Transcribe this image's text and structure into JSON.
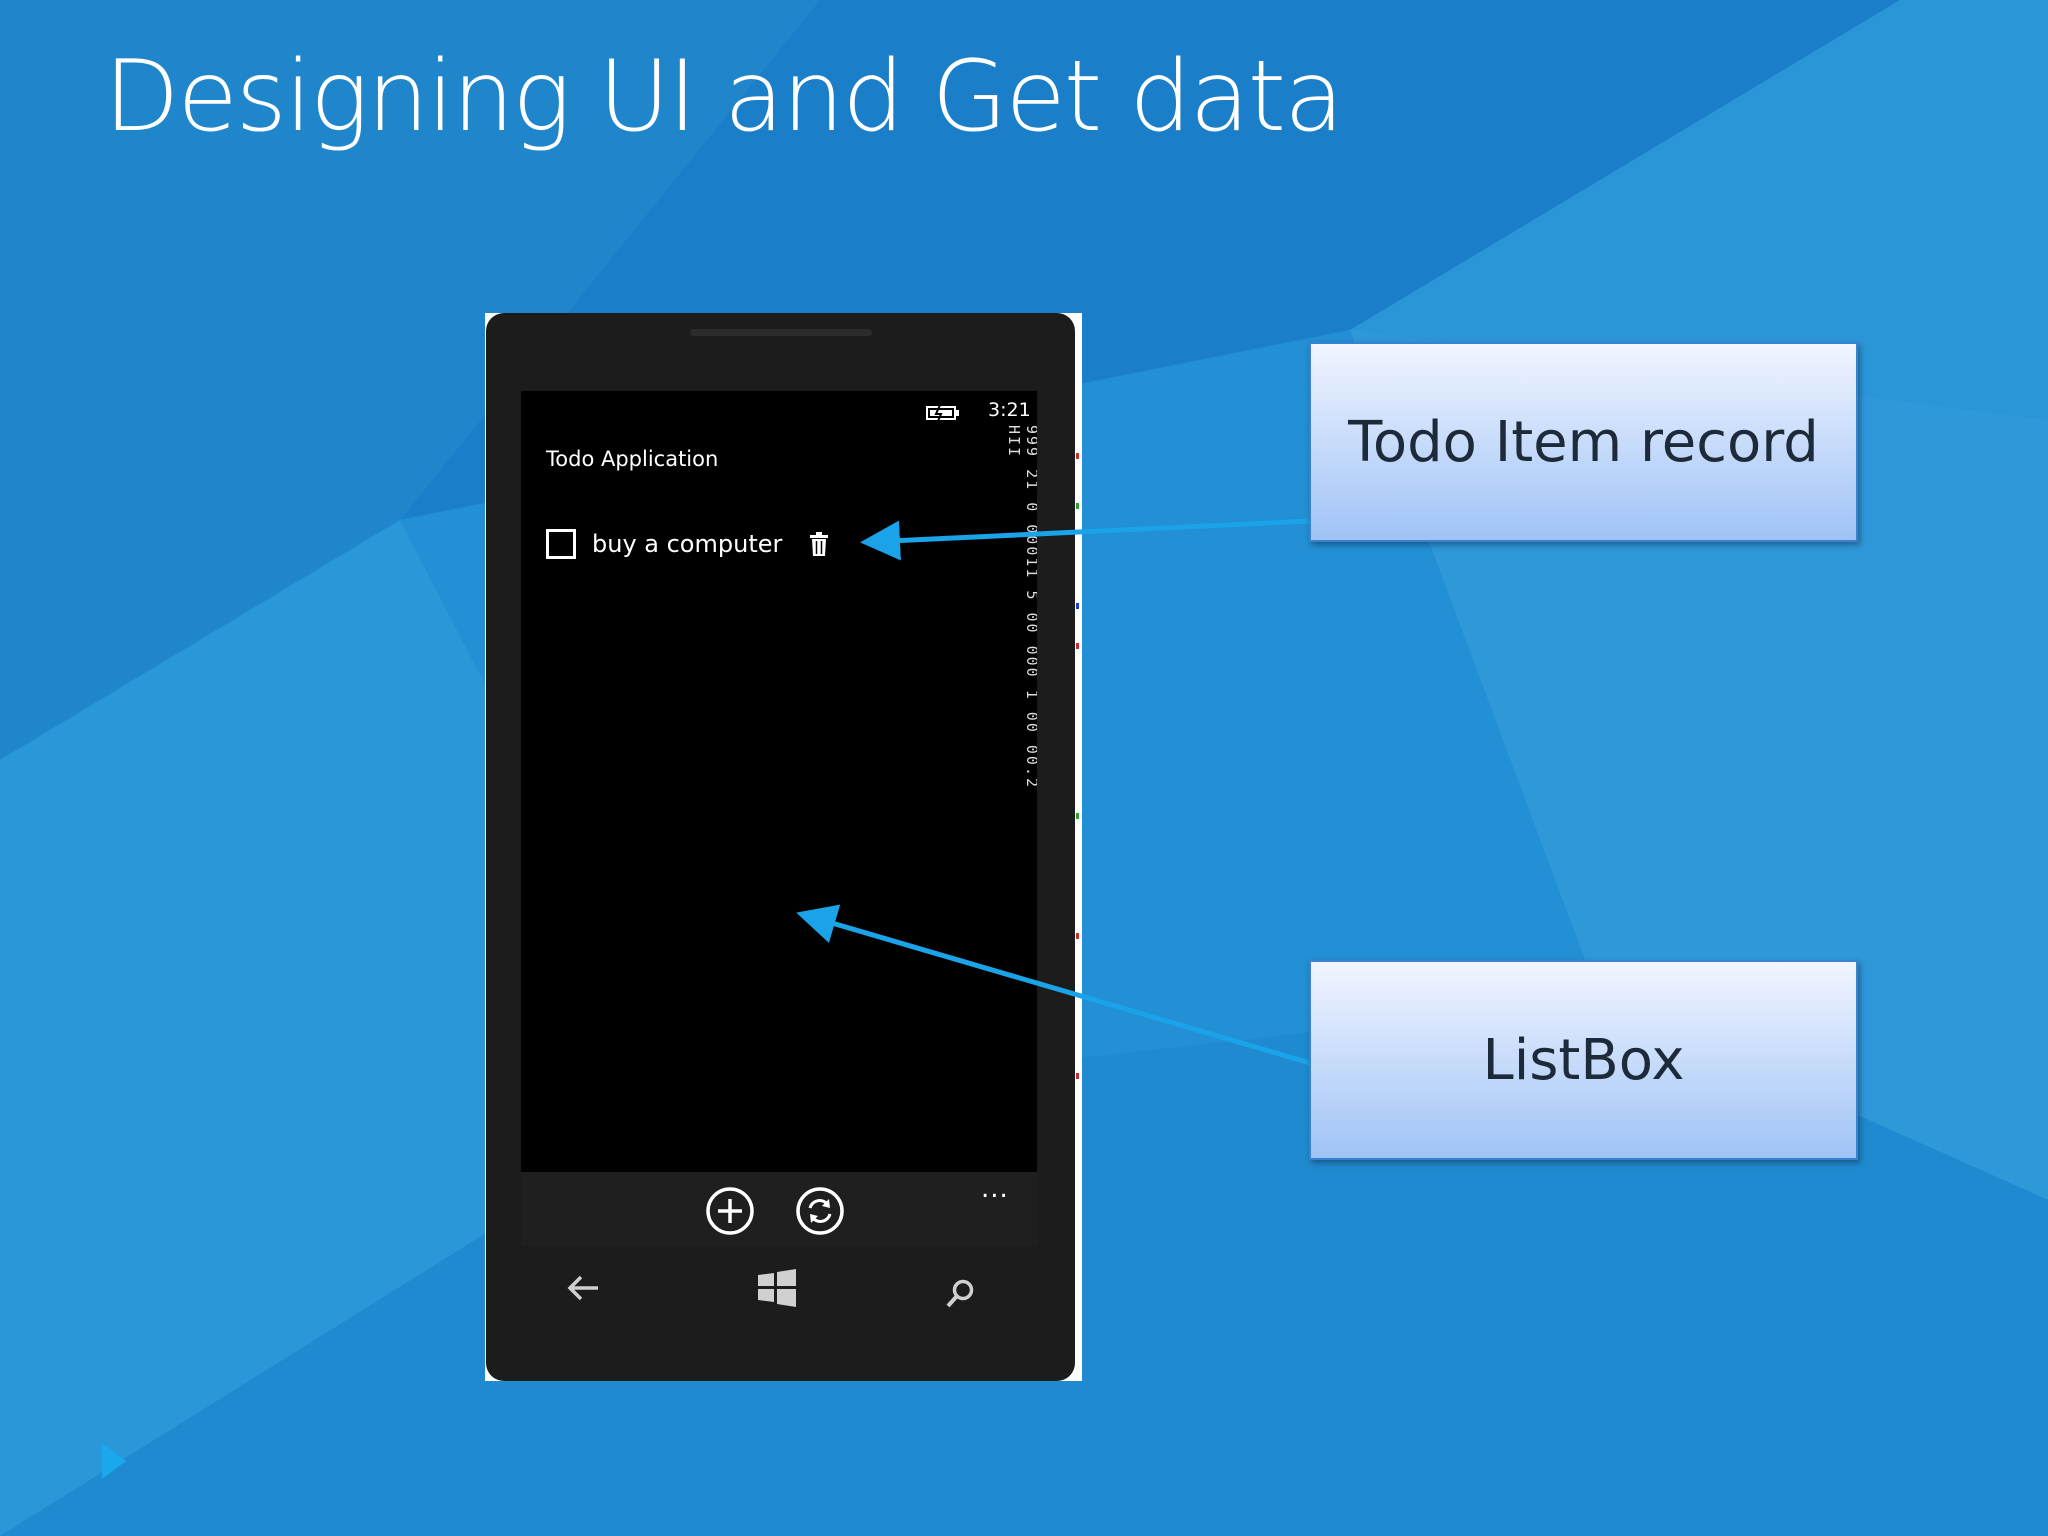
{
  "slide": {
    "title": "Designing UI and Get data"
  },
  "phone": {
    "status_time": "3:21",
    "app_title": "Todo Application",
    "debug_counters": "999 21 0 00011 5 00 000 1 00 00.2 HII",
    "todo_items": [
      {
        "text": "buy a computer",
        "checked": false
      }
    ],
    "appbar": {
      "add_icon": "plus-circle-icon",
      "refresh_icon": "refresh-circle-icon",
      "more_label": "..."
    },
    "nav": {
      "back_icon": "back-arrow-icon",
      "start_icon": "windows-logo-icon",
      "search_icon": "search-icon"
    }
  },
  "callouts": [
    {
      "label": "Todo Item record"
    },
    {
      "label": "ListBox"
    }
  ],
  "colors": {
    "background": "#1f8fd4",
    "callout_border": "#3d7fd0",
    "arrow": "#1aa3e8"
  }
}
